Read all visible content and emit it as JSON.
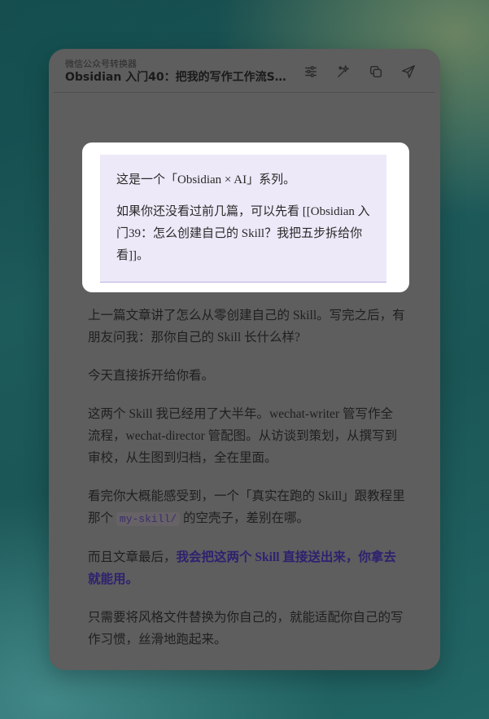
{
  "header": {
    "app_name": "微信公众号转换器",
    "doc_title": "Obsidian 入门40：把我的写作工作流Skill..."
  },
  "toolbar": {
    "icons": [
      "sliders-icon",
      "sparkle-icon",
      "copy-icon",
      "send-icon"
    ]
  },
  "callout": {
    "line1": "这是一个「Obsidian × AI」系列。",
    "line2": "如果你还没看过前几篇，可以先看 [[Obsidian 入门39：怎么创建自己的 Skill？我把五步拆给你看]]。"
  },
  "article": {
    "p1": "上一篇文章讲了怎么从零创建自己的 Skill。写完之后，有朋友问我：那你自己的 Skill 长什么样?",
    "p2": "今天直接拆开给你看。",
    "p3": "这两个 Skill 我已经用了大半年。wechat-writer 管写作全流程，wechat-director 管配图。从访谈到策划，从撰写到审校，从生图到归档，全在里面。",
    "p4_before": "看完你大概能感受到，一个「真实在跑的 Skill」跟教程里那个",
    "p4_code": "my-skill/",
    "p4_after": "的空壳子，差别在哪。",
    "p5_before": "而且文章最后，",
    "p5_emph": "我会把这两个 Skill 直接送出来，你拿去就能用。",
    "p6": "只需要将风格文件替换为你自己的，就能适配你自己的写作习惯，丝滑地跑起来。"
  },
  "colors": {
    "panel": "#5e5e5e",
    "callout_bg": "#ede9f8",
    "emphasis": "#2e2170"
  }
}
